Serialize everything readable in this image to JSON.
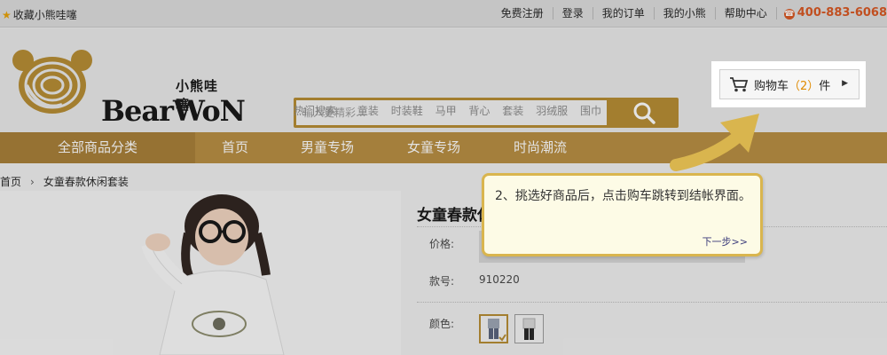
{
  "topbar": {
    "favorite": "收藏小熊哇噻",
    "links": [
      "免费注册",
      "登录",
      "我的订单",
      "我的小熊",
      "帮助中心"
    ],
    "phone": "400-883-6068"
  },
  "logo": {
    "cn": "小熊哇噻",
    "en": "BearWoN"
  },
  "search": {
    "placeholder": "输入更精彩...",
    "hot_label": "热门搜索:",
    "hot_items": [
      "童装",
      "时装鞋",
      "马甲",
      "背心",
      "套装",
      "羽绒服",
      "围巾"
    ]
  },
  "cart": {
    "prefix": "购物车",
    "count_text": "（2）",
    "suffix": "件"
  },
  "nav": {
    "all": "全部商品分类",
    "items": [
      "首页",
      "男童专场",
      "女童专场",
      "时尚潮流"
    ]
  },
  "breadcrumb": {
    "home": "首页",
    "current": "女童春款休闲套装"
  },
  "product": {
    "title": "女童春款休闲套装",
    "price_label": "价格:",
    "code_label": "款号:",
    "code": "910220",
    "color_label": "颜色:"
  },
  "tooltip": {
    "text": "2、挑选好商品后，点击购车跳转到结帐界面。",
    "next": "下一步>>"
  },
  "colors": {
    "accent": "#b58a2e",
    "nav": "#b68b3d",
    "phone": "#d8531c",
    "tip_border": "#d9b54e"
  }
}
